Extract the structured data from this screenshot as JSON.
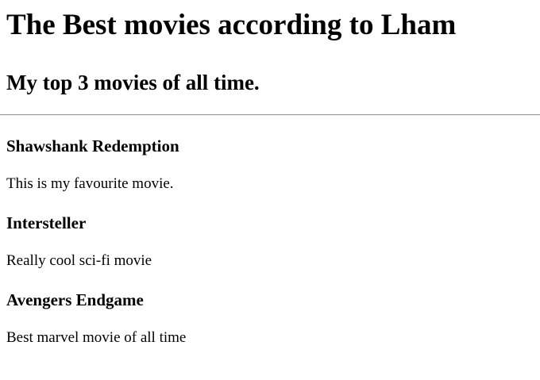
{
  "page": {
    "title": "The Best movies according to Lham",
    "subtitle": "My top 3 movies of all time."
  },
  "movies": [
    {
      "name": "Shawshank Redemption",
      "description": "This is my favourite movie."
    },
    {
      "name": "Intersteller",
      "description": "Really cool sci-fi movie"
    },
    {
      "name": "Avengers Endgame",
      "description": "Best marvel movie of all time"
    }
  ]
}
